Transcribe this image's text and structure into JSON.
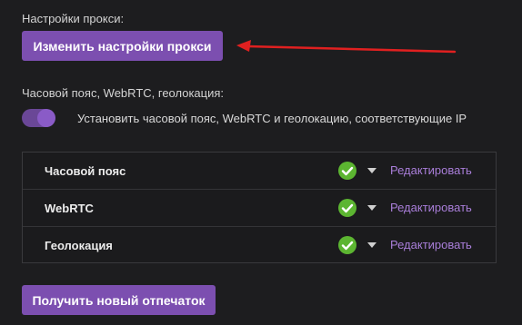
{
  "proxy": {
    "section_label": "Настройки прокси:",
    "change_button": "Изменить настройки прокси"
  },
  "geo": {
    "section_label": "Часовой пояс, WebRTC, геолокация:",
    "toggle_label": "Установить часовой пояс, WebRTC и геолокацию, соответствующие IP",
    "toggle_on": true
  },
  "rows": [
    {
      "label": "Часовой пояс",
      "status": "ok",
      "edit": "Редактировать"
    },
    {
      "label": "WebRTC",
      "status": "ok",
      "edit": "Редактировать"
    },
    {
      "label": "Геолокация",
      "status": "ok",
      "edit": "Редактировать"
    }
  ],
  "fingerprint_button": "Получить новый отпечаток",
  "colors": {
    "accent": "#7c4fb0",
    "link": "#a97ed9",
    "success": "#5cb531",
    "annotation_arrow": "#e02020"
  }
}
